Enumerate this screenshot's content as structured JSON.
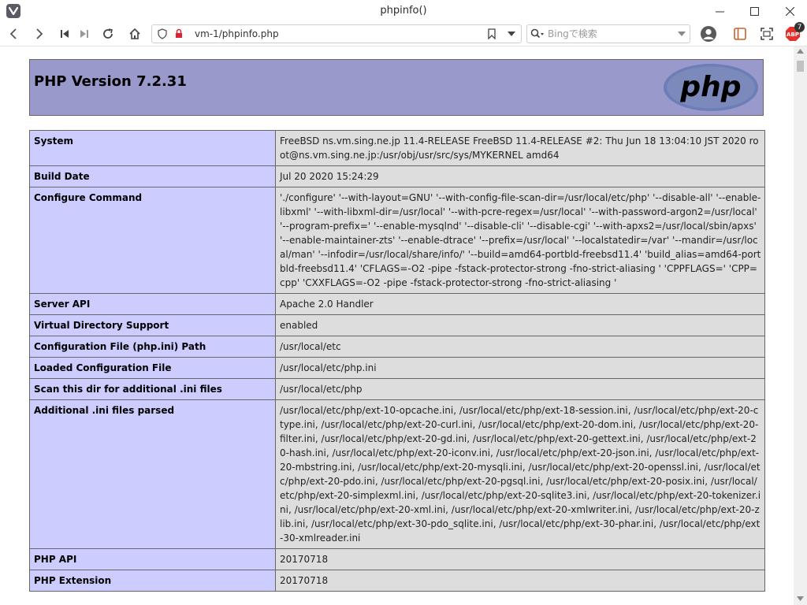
{
  "window": {
    "title": "phpinfo()"
  },
  "toolbar": {
    "url": "vm-1/phpinfo.php",
    "search_placeholder": "Bingで検索",
    "extension_badge": "7"
  },
  "page": {
    "heading": "PHP Version 7.2.31",
    "logo_text": "php",
    "rows": [
      {
        "key": "System",
        "value": "FreeBSD ns.vm.sing.ne.jp 11.4-RELEASE FreeBSD 11.4-RELEASE #2: Thu Jun 18 13:04:10 JST 2020 root@ns.vm.sing.ne.jp:/usr/obj/usr/src/sys/MYKERNEL amd64"
      },
      {
        "key": "Build Date",
        "value": "Jul 20 2020 15:24:29"
      },
      {
        "key": "Configure Command",
        "value": "'./configure' '--with-layout=GNU' '--with-config-file-scan-dir=/usr/local/etc/php' '--disable-all' '--enable-libxml' '--with-libxml-dir=/usr/local' '--with-pcre-regex=/usr/local' '--with-password-argon2=/usr/local' '--program-prefix=' '--enable-mysqlnd' '--disable-cli' '--disable-cgi' '--with-apxs2=/usr/local/sbin/apxs' '--enable-maintainer-zts' '--enable-dtrace' '--prefix=/usr/local' '--localstatedir=/var' '--mandir=/usr/local/man' '--infodir=/usr/local/share/info/' '--build=amd64-portbld-freebsd11.4' 'build_alias=amd64-portbld-freebsd11.4' 'CFLAGS=-O2 -pipe -fstack-protector-strong -fno-strict-aliasing ' 'CPPFLAGS=' 'CPP=cpp' 'CXXFLAGS=-O2 -pipe -fstack-protector-strong -fno-strict-aliasing '"
      },
      {
        "key": "Server API",
        "value": "Apache 2.0 Handler"
      },
      {
        "key": "Virtual Directory Support",
        "value": "enabled"
      },
      {
        "key": "Configuration File (php.ini) Path",
        "value": "/usr/local/etc"
      },
      {
        "key": "Loaded Configuration File",
        "value": "/usr/local/etc/php.ini"
      },
      {
        "key": "Scan this dir for additional .ini files",
        "value": "/usr/local/etc/php"
      },
      {
        "key": "Additional .ini files parsed",
        "value": "/usr/local/etc/php/ext-10-opcache.ini, /usr/local/etc/php/ext-18-session.ini, /usr/local/etc/php/ext-20-ctype.ini, /usr/local/etc/php/ext-20-curl.ini, /usr/local/etc/php/ext-20-dom.ini, /usr/local/etc/php/ext-20-filter.ini, /usr/local/etc/php/ext-20-gd.ini, /usr/local/etc/php/ext-20-gettext.ini, /usr/local/etc/php/ext-20-hash.ini, /usr/local/etc/php/ext-20-iconv.ini, /usr/local/etc/php/ext-20-json.ini, /usr/local/etc/php/ext-20-mbstring.ini, /usr/local/etc/php/ext-20-mysqli.ini, /usr/local/etc/php/ext-20-openssl.ini, /usr/local/etc/php/ext-20-pdo.ini, /usr/local/etc/php/ext-20-pgsql.ini, /usr/local/etc/php/ext-20-posix.ini, /usr/local/etc/php/ext-20-simplexml.ini, /usr/local/etc/php/ext-20-sqlite3.ini, /usr/local/etc/php/ext-20-tokenizer.ini, /usr/local/etc/php/ext-20-xml.ini, /usr/local/etc/php/ext-20-xmlwriter.ini, /usr/local/etc/php/ext-20-zlib.ini, /usr/local/etc/php/ext-30-pdo_sqlite.ini, /usr/local/etc/php/ext-30-phar.ini, /usr/local/etc/php/ext-30-xmlreader.ini"
      },
      {
        "key": "PHP API",
        "value": "20170718"
      },
      {
        "key": "PHP Extension",
        "value": "20170718"
      }
    ]
  },
  "colors": {
    "header_bg": "#9999cc",
    "key_cell_bg": "#ccccff",
    "value_cell_bg": "#dddddd",
    "logo_bg": "#6c7eb7",
    "adblock_red": "#e8302a"
  }
}
